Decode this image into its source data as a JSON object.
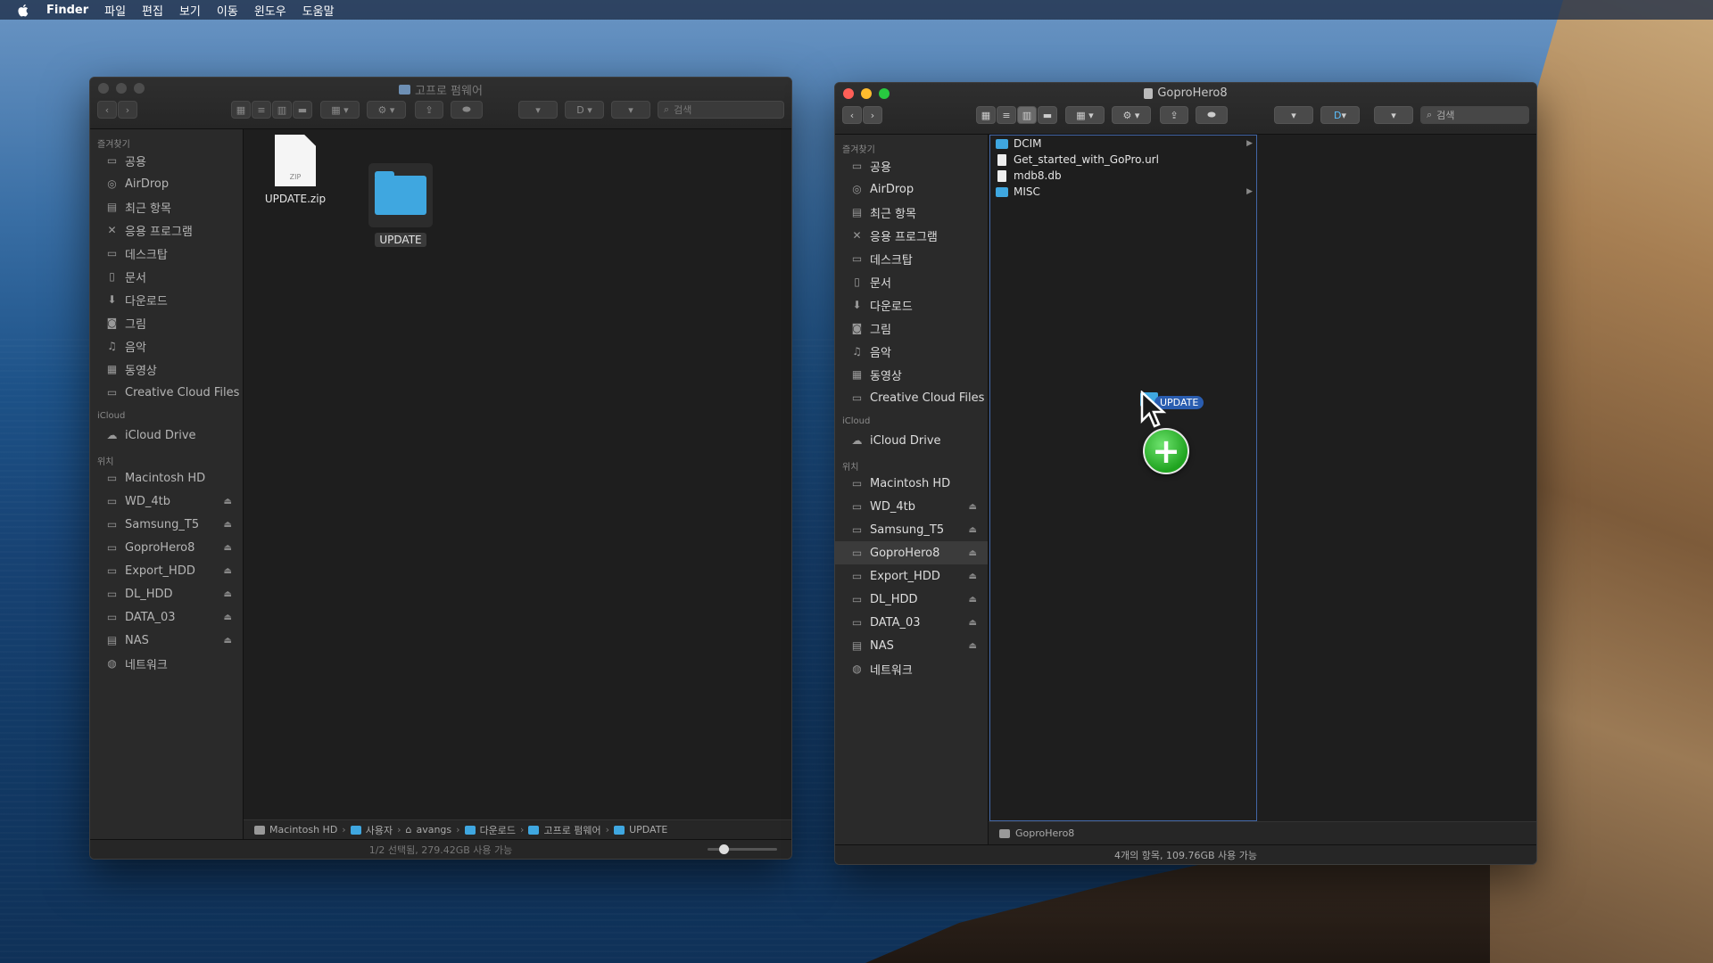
{
  "menubar": {
    "app": "Finder",
    "items": [
      "파일",
      "편집",
      "보기",
      "이동",
      "윈도우",
      "도움말"
    ]
  },
  "left_window": {
    "title": "고프로 펌웨어",
    "search_placeholder": "검색",
    "sidebar": {
      "favorites_header": "즐겨찾기",
      "favorites": [
        "공용",
        "AirDrop",
        "최근 항목",
        "응용 프로그램",
        "데스크탑",
        "문서",
        "다운로드",
        "그림",
        "음악",
        "동영상",
        "Creative Cloud Files"
      ],
      "icloud_header": "iCloud",
      "icloud": [
        "iCloud Drive"
      ],
      "locations_header": "위치",
      "locations": [
        "Macintosh HD",
        "WD_4tb",
        "Samsung_T5",
        "GoproHero8",
        "Export_HDD",
        "DL_HDD",
        "DATA_03",
        "NAS",
        "네트워크"
      ]
    },
    "files": [
      {
        "name": "UPDATE.zip",
        "icon_text": "ZIP"
      },
      {
        "name": "UPDATE"
      }
    ],
    "path": [
      "Macintosh HD",
      "사용자",
      "avangs",
      "다운로드",
      "고프로 펌웨어",
      "UPDATE"
    ],
    "status": "1/2 선택됨, 279.42GB 사용 가능",
    "slider_level": 0.2
  },
  "right_window": {
    "title": "GoproHero8",
    "search_placeholder": "검색",
    "sidebar": {
      "favorites_header": "즐겨찾기",
      "favorites": [
        "공용",
        "AirDrop",
        "최근 항목",
        "응용 프로그램",
        "데스크탑",
        "문서",
        "다운로드",
        "그림",
        "음악",
        "동영상",
        "Creative Cloud Files"
      ],
      "icloud_header": "iCloud",
      "icloud": [
        "iCloud Drive"
      ],
      "locations_header": "위치",
      "locations": [
        "Macintosh HD",
        "WD_4tb",
        "Samsung_T5",
        "GoproHero8",
        "Export_HDD",
        "DL_HDD",
        "DATA_03",
        "NAS",
        "네트워크"
      ],
      "selected": "GoproHero8"
    },
    "column_items": [
      {
        "name": "DCIM",
        "type": "folder"
      },
      {
        "name": "Get_started_with_GoPro.url",
        "type": "file"
      },
      {
        "name": "mdb8.db",
        "type": "file"
      },
      {
        "name": "MISC",
        "type": "folder"
      }
    ],
    "footer_path": "GoproHero8",
    "status": "4개의 항목, 109.76GB 사용 가능"
  },
  "drag": {
    "label": "UPDATE",
    "badge": "+"
  }
}
